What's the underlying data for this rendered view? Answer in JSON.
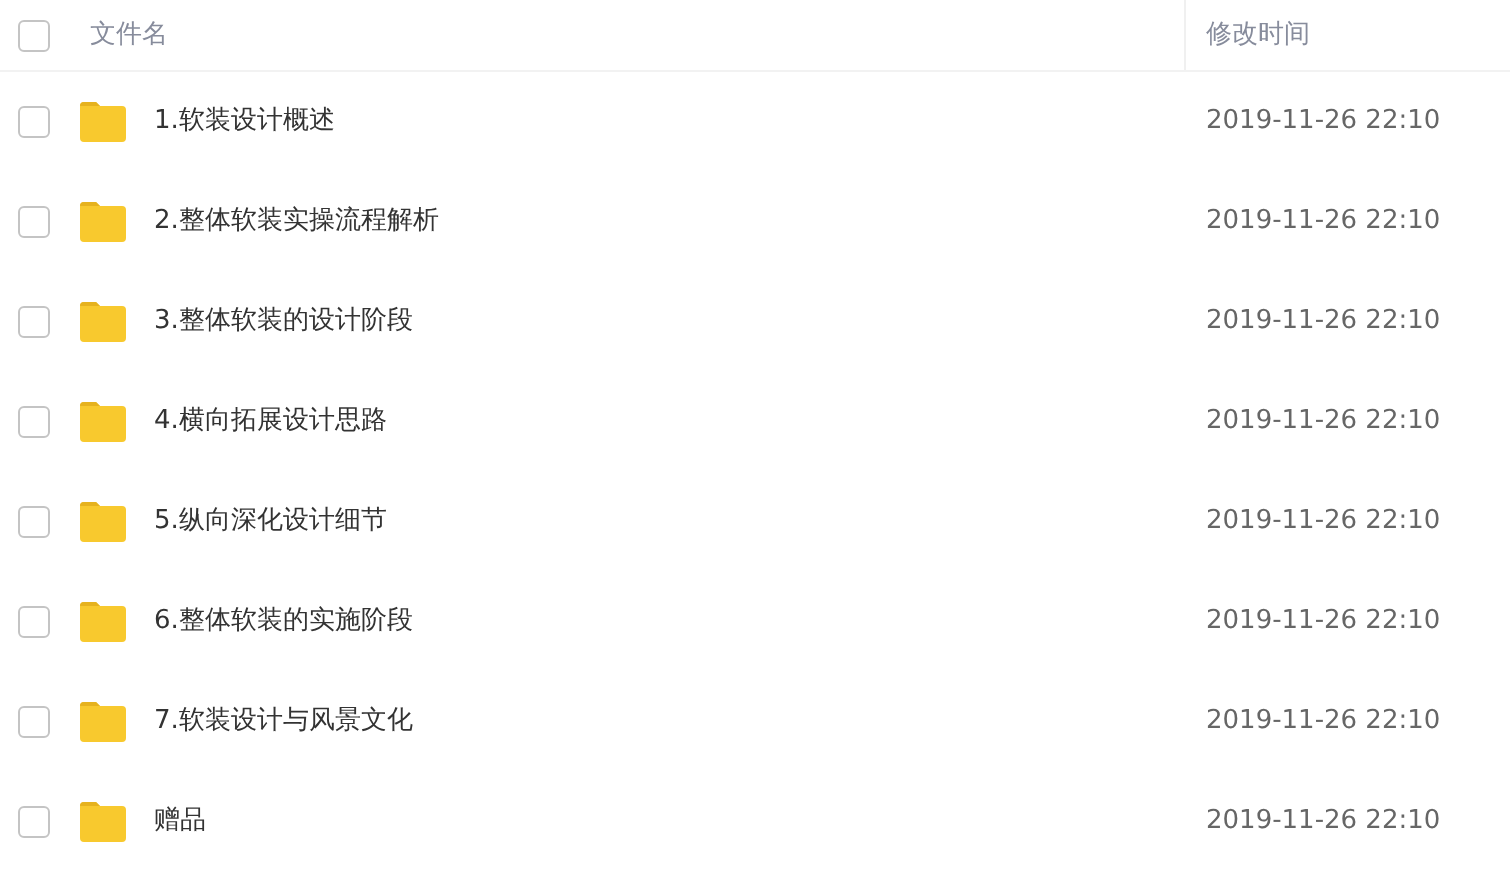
{
  "header": {
    "checked": false,
    "columns": [
      "文件名",
      "修改时间"
    ]
  },
  "rows": [
    {
      "name": "1.软装设计概述",
      "modified": "2019-11-26 22:10",
      "checked": false
    },
    {
      "name": "2.整体软装实操流程解析",
      "modified": "2019-11-26 22:10",
      "checked": false
    },
    {
      "name": "3.整体软装的设计阶段",
      "modified": "2019-11-26 22:10",
      "checked": false
    },
    {
      "name": "4.横向拓展设计思路",
      "modified": "2019-11-26 22:10",
      "checked": false
    },
    {
      "name": "5.纵向深化设计细节",
      "modified": "2019-11-26 22:10",
      "checked": false
    },
    {
      "name": "6.整体软装的实施阶段",
      "modified": "2019-11-26 22:10",
      "checked": false
    },
    {
      "name": "7.软装设计与风景文化",
      "modified": "2019-11-26 22:10",
      "checked": false
    },
    {
      "name": "赠品",
      "modified": "2019-11-26 22:10",
      "checked": false
    }
  ]
}
